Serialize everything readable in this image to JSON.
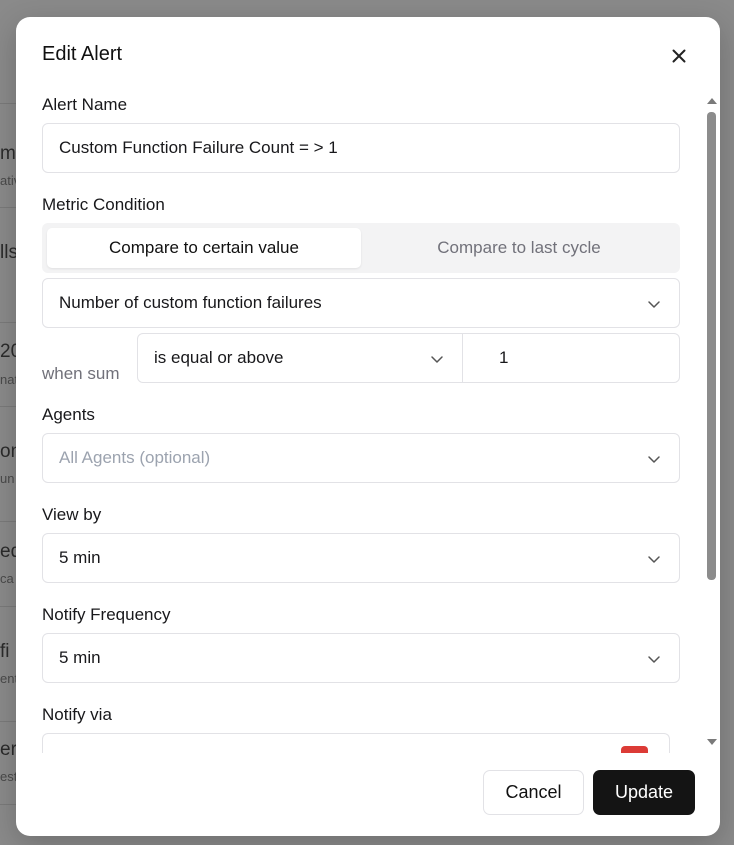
{
  "background": {
    "fragments": [
      {
        "text": "me",
        "sub": "ativ"
      },
      {
        "text": "lls",
        "sub": ""
      },
      {
        "text": "20",
        "sub": "nat"
      },
      {
        "text": "on",
        "sub": "un"
      },
      {
        "text": "ed",
        "sub": "ca"
      },
      {
        "text": "fi",
        "sub": "ent"
      },
      {
        "text": "er",
        "sub": "est"
      }
    ]
  },
  "modal": {
    "title": "Edit Alert",
    "close_icon": "close-icon",
    "alert_name": {
      "label": "Alert Name",
      "value": "Custom Function Failure Count = > 1"
    },
    "metric_condition": {
      "label": "Metric Condition",
      "tabs": [
        "Compare to certain value",
        "Compare to last cycle"
      ],
      "active_tab": "Compare to certain value",
      "metric": "Number of custom function failures",
      "when_label": "when sum",
      "operator": "is equal or above",
      "threshold": "1"
    },
    "agents": {
      "label": "Agents",
      "placeholder": "All Agents (optional)"
    },
    "view_by": {
      "label": "View by",
      "value": "5 min"
    },
    "notify_frequency": {
      "label": "Notify Frequency",
      "value": "5 min"
    },
    "notify_via": {
      "label": "Notify via"
    },
    "buttons": {
      "cancel": "Cancel",
      "update": "Update"
    }
  },
  "colors": {
    "overlay": "#7f7f7f",
    "primary_button": "#141414",
    "notify_chip": "#dc3b36"
  }
}
